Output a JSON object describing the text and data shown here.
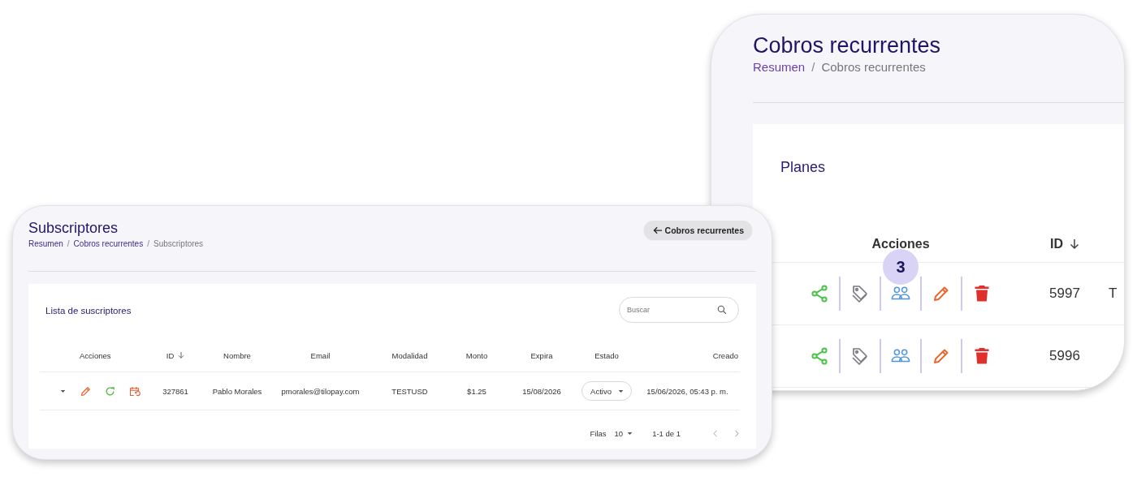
{
  "plans_window": {
    "title": "Cobros recurrentes",
    "breadcrumb": [
      {
        "kind": "link",
        "label": "Resumen"
      },
      {
        "kind": "separator",
        "label": "/"
      },
      {
        "kind": "current",
        "label": "Cobros recurrentes"
      }
    ],
    "section_title": "Planes",
    "columns": [
      {
        "label": "Acciones",
        "sorted": false
      },
      {
        "label": "ID",
        "sorted": true
      }
    ],
    "rows": [
      {
        "actions": [
          {
            "kind": "share"
          },
          {
            "kind": "tag"
          },
          {
            "kind": "people",
            "badge": "3"
          },
          {
            "kind": "edit"
          },
          {
            "kind": "delete"
          }
        ],
        "id": "5997",
        "column_3": "T"
      },
      {
        "actions": [
          {
            "kind": "share"
          },
          {
            "kind": "tag"
          },
          {
            "kind": "people"
          },
          {
            "kind": "edit"
          },
          {
            "kind": "delete"
          }
        ],
        "id": "5996"
      }
    ]
  },
  "subscribers_window": {
    "title": "Subscriptores",
    "breadcrumb": [
      {
        "kind": "link",
        "label": "Resumen"
      },
      {
        "kind": "separator",
        "label": "/"
      },
      {
        "kind": "link",
        "label": "Cobros recurrentes"
      },
      {
        "kind": "separator",
        "label": "/"
      },
      {
        "kind": "current",
        "label": "Subscriptores"
      }
    ],
    "back_button": "Cobros recurrentes",
    "list_title": "Lista de suscriptores",
    "search": {
      "placeholder": "Buscar"
    },
    "columns": [
      {
        "kind": "expand"
      },
      {
        "kind": "text",
        "label": "Acciones",
        "sorted": false
      },
      {
        "kind": "text",
        "label": "ID",
        "sorted": true
      },
      {
        "kind": "text",
        "label": "Nombre",
        "sorted": false
      },
      {
        "kind": "text",
        "label": "Email",
        "sorted": false
      },
      {
        "kind": "text",
        "label": "Modalidad",
        "sorted": false
      },
      {
        "kind": "text",
        "label": "Monto",
        "sorted": false
      },
      {
        "kind": "text",
        "label": "Expira",
        "sorted": false
      },
      {
        "kind": "text",
        "label": "Estado",
        "sorted": false
      },
      {
        "kind": "text",
        "label": "Creado",
        "sorted": false
      }
    ],
    "rows": [
      {
        "cells": [
          {
            "kind": "expand",
            "expanded": false
          },
          {
            "kind": "actions",
            "actions": [
              {
                "kind": "edit"
              },
              {
                "kind": "renew"
              },
              {
                "kind": "schedule"
              }
            ]
          },
          "327861",
          "Pablo Morales",
          "pmorales@tilopay.com",
          "TESTUSD",
          "$1.25",
          "15/08/2026",
          {
            "kind": "select",
            "value": "Activo"
          },
          "15/06/2026, 05:43 p. m."
        ]
      }
    ],
    "pagination": {
      "rows_label": "Filas",
      "rows_per_page": "10",
      "range": "1-1 de 1"
    }
  }
}
